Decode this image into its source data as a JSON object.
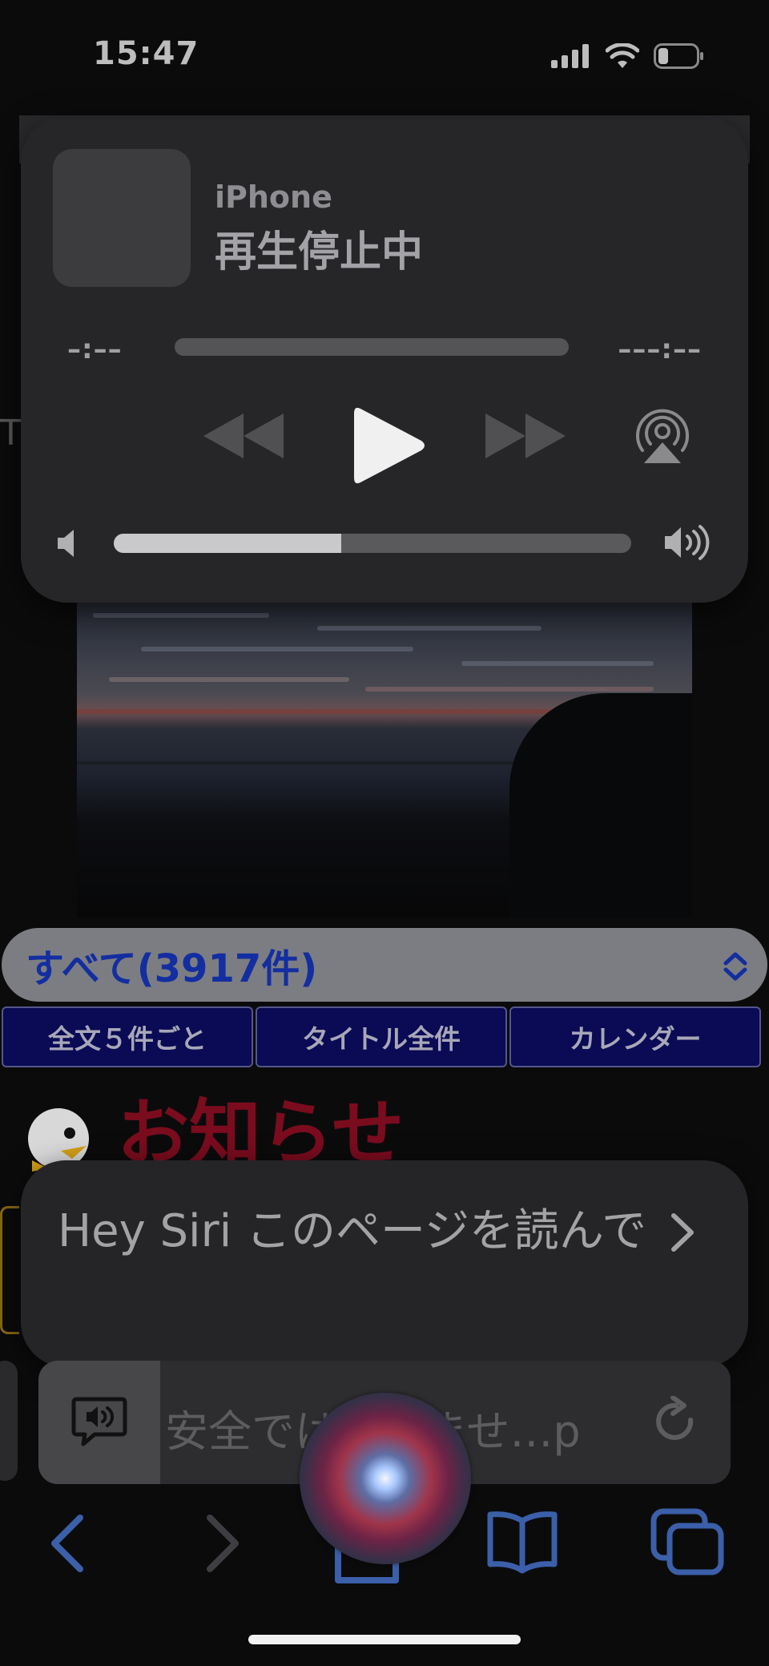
{
  "status": {
    "time": "15:47"
  },
  "background_page": {
    "edge_letter": "T",
    "filter_select": {
      "label": "すべて(3917件)"
    },
    "nav_buttons": [
      "全文５件ごと",
      "タイトル全件",
      "カレンダー"
    ],
    "notice_title": "お知らせ"
  },
  "now_playing": {
    "device": "iPhone",
    "state": "再生停止中",
    "elapsed": "–:––",
    "remaining": "–––:––",
    "volume_level": 0.44
  },
  "siri_suggestion": {
    "text": "Hey Siri このページを読んで"
  },
  "address_bar": {
    "url_text": "安全ではありませ…p"
  },
  "icons": {
    "signal": "cellular-signal-icon",
    "wifi": "wifi-icon",
    "battery": "battery-icon",
    "rewind": "rewind-icon",
    "play": "play-icon",
    "forward": "fast-forward-icon",
    "airplay": "airplay-icon",
    "volume_low": "speaker-low-icon",
    "volume_high": "speaker-high-icon",
    "reader": "listen-page-icon",
    "reload": "reload-icon",
    "back": "back-chevron-icon",
    "forward_nav": "forward-chevron-icon",
    "bookmarks": "book-icon",
    "tabs": "tabs-icon"
  },
  "colors": {
    "accent_blue": "#3b5fa8",
    "notice_red": "#7a0c1e",
    "nav_button_bg": "#0a0a55"
  }
}
